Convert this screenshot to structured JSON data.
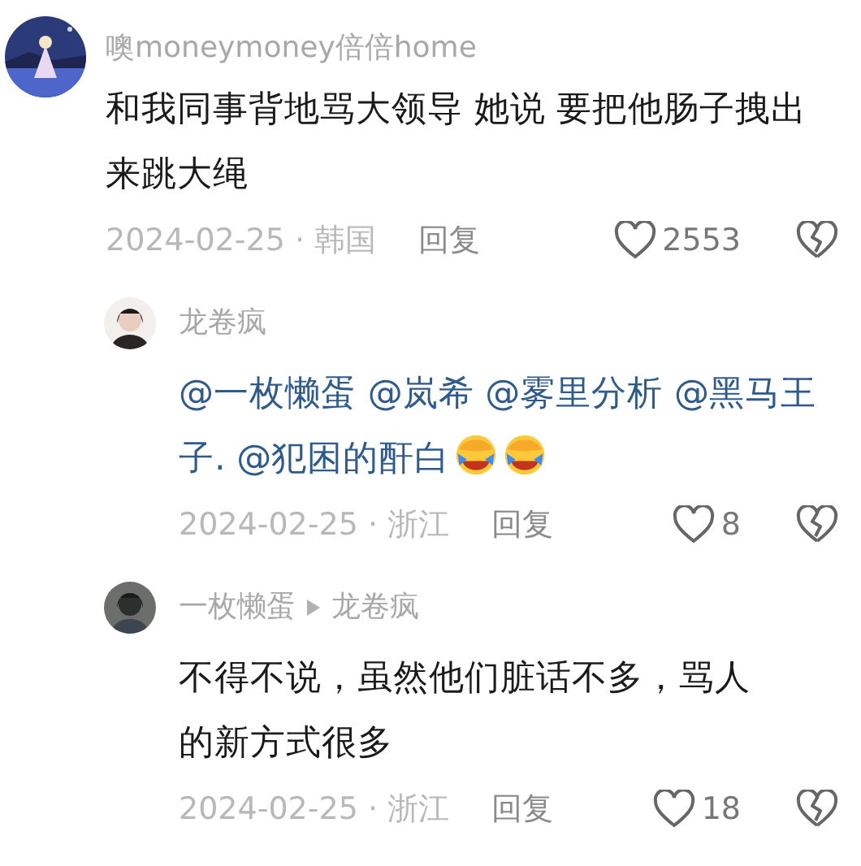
{
  "comments": [
    {
      "author": "噢moneymoney倍倍home",
      "segments": [
        {
          "kind": "text",
          "text": "和我同事背地骂大领导 她说 要把他肠子拽出来跳大绳"
        }
      ],
      "date": "2024-02-25 · 韩国",
      "reply": "回复",
      "likes": "2553",
      "replies": [
        {
          "author": "龙卷疯",
          "segments": [
            {
              "kind": "mention",
              "text": "@一枚懒蛋 @岚希 @雾里分析 @黑马王"
            },
            {
              "kind": "mention",
              "text": "子. @犯困的酐白"
            },
            {
              "kind": "emoji"
            },
            {
              "kind": "emoji"
            }
          ],
          "date": "2024-02-25 · 浙江",
          "reply": "回复",
          "likes": "8"
        },
        {
          "author": "一枚懒蛋",
          "reply_to": "龙卷疯",
          "segments": [
            {
              "kind": "text",
              "text": "不得不说，虽然他们脏话不多，骂人的新方式很多"
            }
          ],
          "date": "2024-02-25 · 浙江",
          "reply": "回复",
          "likes": "18"
        }
      ]
    }
  ]
}
